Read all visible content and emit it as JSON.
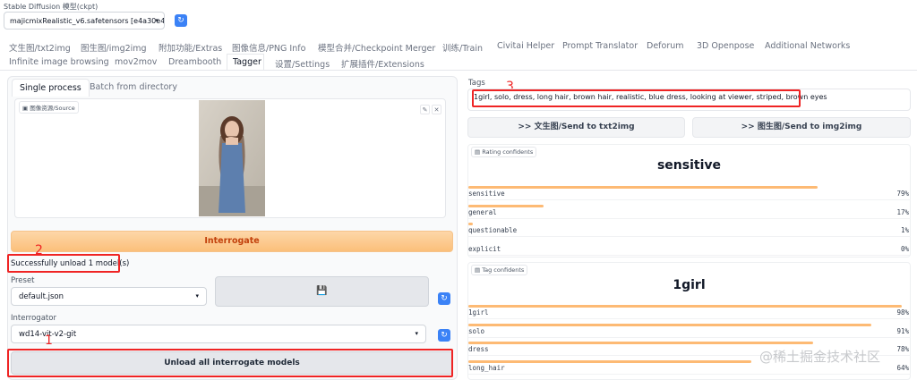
{
  "model": {
    "label": "Stable Diffusion 模型(ckpt)",
    "value": "majicmixRealistic_v6.safetensors [e4a30e4"
  },
  "tabs": {
    "row1": [
      "文生图/txt2img",
      "图生图/img2img",
      "附加功能/Extras",
      "图像信息/PNG Info",
      "模型合并/Checkpoint Merger",
      "训练/Train",
      "Civitai Helper",
      "Prompt Translator",
      "Deforum",
      "3D Openpose",
      "Additional Networks"
    ],
    "row2": [
      "Infinite image browsing",
      "mov2mov",
      "Dreambooth",
      "Tagger",
      "设置/Settings",
      "扩展插件/Extensions"
    ],
    "active": "Tagger"
  },
  "left": {
    "subtabs": [
      "Single process",
      "Batch from directory"
    ],
    "source_label": "图像资源/Source",
    "interrogate_label": "Interrogate",
    "status": "Successfully unload 1 model(s)",
    "preset_label": "Preset",
    "preset_value": "default.json",
    "save_icon": "💾",
    "interrogator_label": "Interrogator",
    "interrogator_value": "wd14-vit-v2-git",
    "unload_label": "Unload all interrogate models"
  },
  "annotations": {
    "n1": "1",
    "n2": "2",
    "n3": "3",
    "color": "#ef2424"
  },
  "right": {
    "tags_label": "Tags",
    "tags_value": "1girl, solo, dress, long hair, brown hair, realistic, blue dress, looking at viewer, striped, brown eyes",
    "send_txt2img": ">> 文生图/Send to txt2img",
    "send_img2img": ">> 图生图/Send to img2img",
    "rating": {
      "label": "Rating confidents",
      "top": "sensitive",
      "rows": [
        {
          "name": "sensitive",
          "value": "79%",
          "fraction": 0.79
        },
        {
          "name": "general",
          "value": "17%",
          "fraction": 0.17
        },
        {
          "name": "questionable",
          "value": "1%",
          "fraction": 0.01
        },
        {
          "name": "explicit",
          "value": "0%",
          "fraction": 0.0
        }
      ]
    },
    "tag": {
      "label": "Tag confidents",
      "top": "1girl",
      "rows": [
        {
          "name": "1girl",
          "value": "98%",
          "fraction": 0.98
        },
        {
          "name": "solo",
          "value": "91%",
          "fraction": 0.91
        },
        {
          "name": "dress",
          "value": "78%",
          "fraction": 0.78
        },
        {
          "name": "long_hair",
          "value": "64%",
          "fraction": 0.64
        }
      ]
    }
  },
  "watermark": "@稀土掘金技术社区",
  "colors": {
    "accent": "#3b82f6",
    "interrogate": "#fbbf7a",
    "bar": "#fdba74"
  }
}
